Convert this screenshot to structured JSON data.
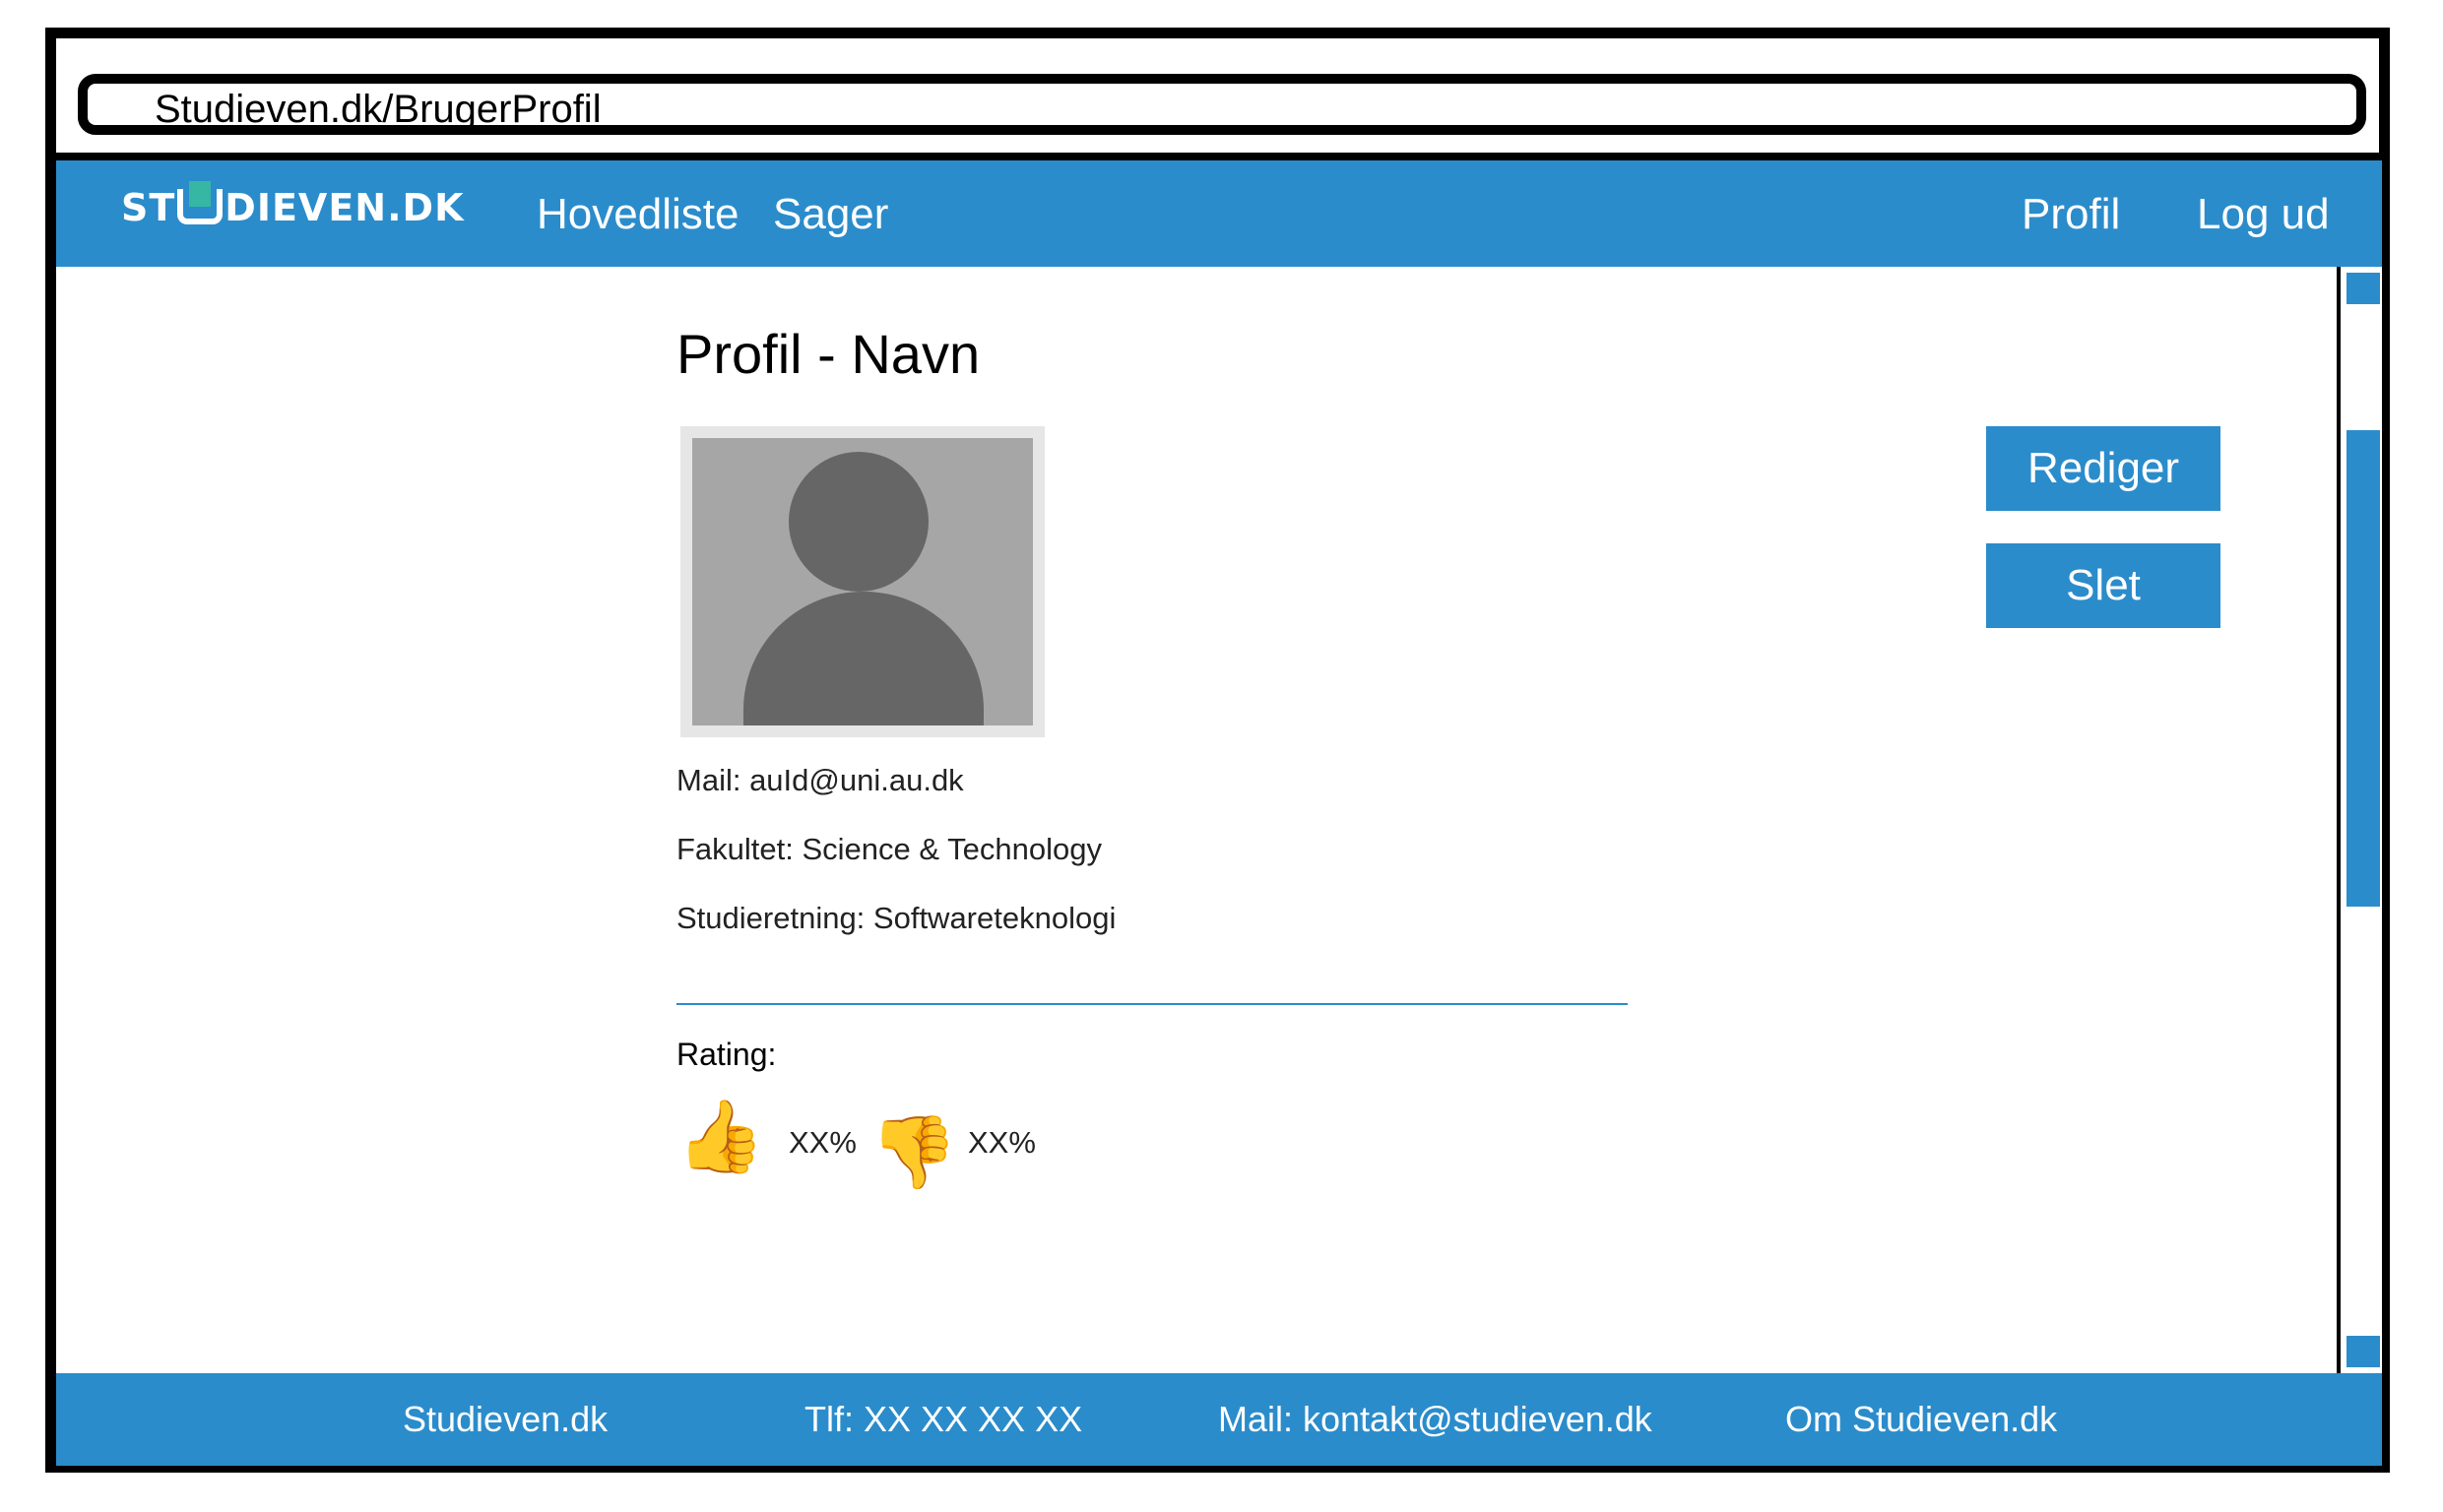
{
  "browser": {
    "url": "Studieven.dk/BrugerProfil"
  },
  "navbar": {
    "logo_left": "ST",
    "logo_right": "DIEVEN.DK",
    "links": [
      "Hovedliste",
      "Sager"
    ],
    "right_links": [
      "Profil",
      "Log ud"
    ]
  },
  "profile": {
    "title": "Profil - Navn",
    "mail": "Mail: auId@uni.au.dk",
    "fakultet": "Fakultet: Science & Technology",
    "studieretning": "Studieretning: Softwareteknologi",
    "rating_label": "Rating:",
    "thumbs_up_pct": "XX%",
    "thumbs_down_pct": "XX%",
    "thumbs_up_icon": "👍",
    "thumbs_down_icon": "👎"
  },
  "actions": {
    "edit": "Rediger",
    "delete": "Slet"
  },
  "footer": {
    "items": [
      "Studieven.dk",
      "Tlf: XX XX XX XX",
      "Mail: kontakt@studieven.dk",
      "Om Studieven.dk"
    ]
  },
  "colors": {
    "brand": "#2b8ccb",
    "logo_accent": "#35b7a4"
  }
}
